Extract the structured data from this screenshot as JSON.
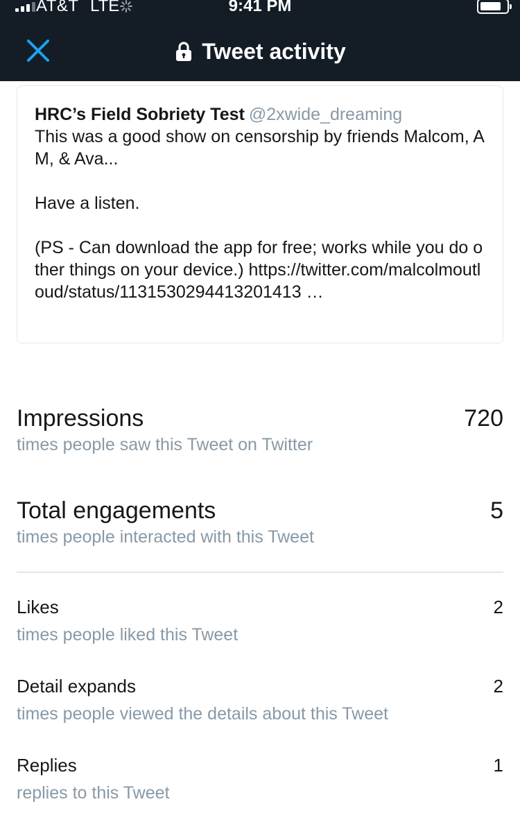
{
  "status_bar": {
    "carrier": "AT&T",
    "network": "LTE",
    "time": "9:41 PM"
  },
  "header": {
    "title": "Tweet activity",
    "close_icon": "close-icon",
    "lock_icon": "lock-icon",
    "accent_color": "#1da1f2",
    "background_color": "#141d26"
  },
  "tweet": {
    "author_name": "HRC’s Field Sobriety Test",
    "author_handle": "@2xwide_dreaming",
    "text": "This was a good show on censorship by friends Malcom, AM, & Ava...\n\nHave a listen.\n\n(PS - Can download the app for free; works while you do other things on your device.) https://twitter.com/malcolmoutloud/status/1131530294413201413 …"
  },
  "metrics": {
    "impressions": {
      "label": "Impressions",
      "value": "720",
      "description": "times people saw this Tweet on Twitter"
    },
    "total_engagements": {
      "label": "Total engagements",
      "value": "5",
      "description": "times people interacted with this Tweet"
    }
  },
  "breakdown": [
    {
      "label": "Likes",
      "value": "2",
      "description": "times people liked this Tweet"
    },
    {
      "label": "Detail expands",
      "value": "2",
      "description": "times people viewed the details about this Tweet"
    },
    {
      "label": "Replies",
      "value": "1",
      "description": "replies to this Tweet"
    }
  ]
}
